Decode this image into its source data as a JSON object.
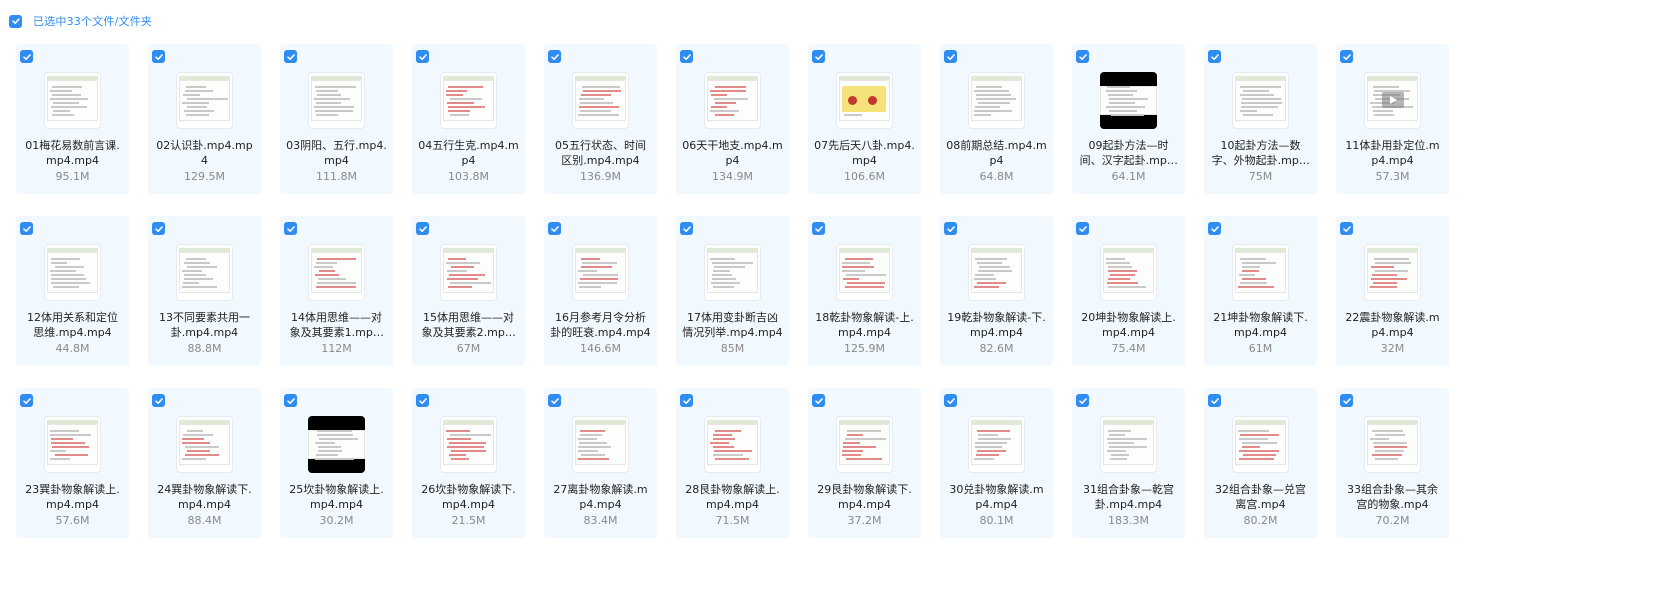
{
  "selection": {
    "label": "已选中33个文件/文件夹",
    "checked": true
  },
  "accent": "#2f8cf0",
  "files": [
    {
      "name": "01梅花易数前言课.mp4.mp4",
      "size": "95.1M",
      "thumb": "doc"
    },
    {
      "name": "02认识卦.mp4.mp4",
      "size": "129.5M",
      "thumb": "doc"
    },
    {
      "name": "03阴阳、五行.mp4.mp4",
      "size": "111.8M",
      "thumb": "doc"
    },
    {
      "name": "04五行生克.mp4.mp4",
      "size": "103.8M",
      "thumb": "doc-red"
    },
    {
      "name": "05五行状态、时间区别.mp4.mp4",
      "size": "136.9M",
      "thumb": "doc-red"
    },
    {
      "name": "06天干地支.mp4.mp4",
      "size": "134.9M",
      "thumb": "doc-red"
    },
    {
      "name": "07先后天八卦.mp4.mp4",
      "size": "106.6M",
      "thumb": "doc-yellow"
    },
    {
      "name": "08前期总结.mp4.mp4",
      "size": "64.8M",
      "thumb": "doc"
    },
    {
      "name": "09起卦方法—时间、汉字起卦.mp4.mp4",
      "size": "64.1M",
      "thumb": "dark"
    },
    {
      "name": "10起卦方法—数字、外物起卦.mp4.mp4",
      "size": "75M",
      "thumb": "doc"
    },
    {
      "name": "11体卦用卦定位.mp4.mp4",
      "size": "57.3M",
      "thumb": "video"
    },
    {
      "name": "12体用关系和定位思维.mp4.mp4",
      "size": "44.8M",
      "thumb": "doc"
    },
    {
      "name": "13不同要素共用一卦.mp4.mp4",
      "size": "88.8M",
      "thumb": "doc"
    },
    {
      "name": "14体用思维——对象及其要素1.mp4.mp4",
      "size": "112M",
      "thumb": "doc-red"
    },
    {
      "name": "15体用思维——对象及其要素2.mp4.mp4",
      "size": "67M",
      "thumb": "doc-red"
    },
    {
      "name": "16月参考月令分析卦的旺衰.mp4.mp4",
      "size": "146.6M",
      "thumb": "doc-red"
    },
    {
      "name": "17体用变卦断吉凶情况列举.mp4.mp4",
      "size": "85M",
      "thumb": "doc"
    },
    {
      "name": "18乾卦物象解读-上.mp4.mp4",
      "size": "125.9M",
      "thumb": "doc-red"
    },
    {
      "name": "19乾卦物象解读-下.mp4.mp4",
      "size": "82.6M",
      "thumb": "doc-red"
    },
    {
      "name": "20坤卦物象解读上.mp4.mp4",
      "size": "75.4M",
      "thumb": "doc-red"
    },
    {
      "name": "21坤卦物象解读下.mp4.mp4",
      "size": "61M",
      "thumb": "doc-red"
    },
    {
      "name": "22震卦物象解读.mp4.mp4",
      "size": "32M",
      "thumb": "doc-red"
    },
    {
      "name": "23巽卦物象解读上.mp4.mp4",
      "size": "57.6M",
      "thumb": "doc-red"
    },
    {
      "name": "24巽卦物象解读下.mp4.mp4",
      "size": "88.4M",
      "thumb": "doc-red"
    },
    {
      "name": "25坎卦物象解读上.mp4.mp4",
      "size": "30.2M",
      "thumb": "dark"
    },
    {
      "name": "26坎卦物象解读下.mp4.mp4",
      "size": "21.5M",
      "thumb": "doc-red"
    },
    {
      "name": "27离卦物象解读.mp4.mp4",
      "size": "83.4M",
      "thumb": "doc-red"
    },
    {
      "name": "28艮卦物象解读上.mp4.mp4",
      "size": "71.5M",
      "thumb": "doc-red"
    },
    {
      "name": "29艮卦物象解读下.mp4.mp4",
      "size": "37.2M",
      "thumb": "doc-red"
    },
    {
      "name": "30兑卦物象解读.mp4.mp4",
      "size": "80.1M",
      "thumb": "doc-red"
    },
    {
      "name": "31组合卦象—乾宫卦.mp4.mp4",
      "size": "183.3M",
      "thumb": "doc"
    },
    {
      "name": "32组合卦象—兑宫离宫.mp4",
      "size": "80.2M",
      "thumb": "doc-red"
    },
    {
      "name": "33组合卦象—其余宫的物象.mp4",
      "size": "70.2M",
      "thumb": "doc-red"
    }
  ]
}
